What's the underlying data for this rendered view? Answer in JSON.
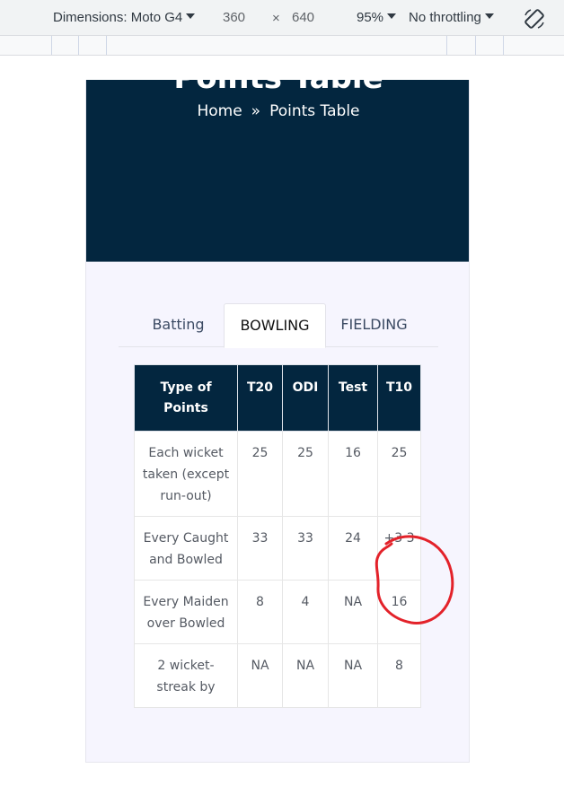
{
  "devtools": {
    "dimensions_label": "Dimensions: Moto G4",
    "width": "360",
    "times": "×",
    "height": "640",
    "zoom": "95%",
    "throttling": "No throttling",
    "rotate_icon": "rotate-device-icon"
  },
  "hero": {
    "title": "Points Table",
    "breadcrumb_home": "Home",
    "breadcrumb_separator": "»",
    "breadcrumb_current": "Points Table"
  },
  "tabs": [
    "Batting",
    "BOWLING",
    "FIELDING"
  ],
  "table": {
    "headers": [
      "Type of Points",
      "T20",
      "ODI",
      "Test",
      "T10"
    ],
    "rows": [
      [
        "Each wicket taken (except run-out)",
        "25",
        "25",
        "16",
        "25"
      ],
      [
        "Every Caught and Bowled",
        "33",
        "33",
        "24",
        "+3 3"
      ],
      [
        "Every Maiden over Bowled",
        "8",
        "4",
        "NA",
        "16"
      ],
      [
        "2 wicket-streak by",
        "NA",
        "NA",
        "NA",
        "8"
      ]
    ]
  },
  "colors": {
    "hero_bg": "#03263f",
    "page_bg": "#f6f5fe",
    "annotation": "#e3222a"
  }
}
